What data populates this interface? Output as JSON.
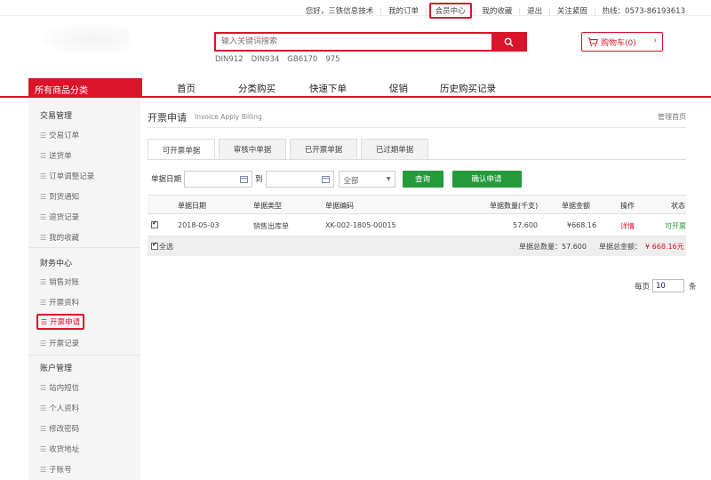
{
  "topbar": {
    "greeting": "您好，三铁信息技术",
    "my_orders": "我的订单",
    "member_center": "会员中心",
    "my_favorites": "我的收藏",
    "logout": "退出",
    "follow": "关注紧固",
    "hotline": "热线：0573-86193613"
  },
  "header": {
    "search_placeholder": "输入关键词搜索",
    "hot_words": [
      "DIN912",
      "DIN934",
      "GB6170",
      "975"
    ],
    "cart_label": "购物车(0)"
  },
  "nav": {
    "all_categories": "所有商品分类",
    "items": [
      "首页",
      "分类购买",
      "快速下单",
      "促销",
      "历史购买记录"
    ]
  },
  "sidebar": {
    "groups": [
      {
        "title": "交易管理",
        "items": [
          "交易订单",
          "送货单",
          "订单调整记录",
          "到货通知",
          "退货记录",
          "我的收藏"
        ]
      },
      {
        "title": "财务中心",
        "items": [
          "销售对账",
          "开票资料",
          "开票申请",
          "开票记录"
        ]
      },
      {
        "title": "账户管理",
        "items": [
          "站内短信",
          "个人资料",
          "修改密码",
          "收货地址",
          "子账号"
        ]
      }
    ],
    "active_item": "开票申请"
  },
  "main": {
    "title": "开票申请",
    "subtitle": "Invoice Apply Billing",
    "breadcrumb": "管理首页",
    "tabs": [
      "可开票单据",
      "审核中单据",
      "已开票单据",
      "已过期单据"
    ],
    "filter": {
      "date_label": "单据日期",
      "to_label": "到",
      "select_value": "全部",
      "query_button": "查询",
      "confirm_button": "确认申请"
    },
    "table": {
      "headers": [
        "单据日期",
        "单据类型",
        "单据编码",
        "单据数量(千支)",
        "单据金额",
        "操作",
        "状态"
      ],
      "rows": [
        {
          "date": "2018-05-03",
          "type": "销售出库单",
          "code": "XK-002-1805-00015",
          "qty": "57.600",
          "amount": "¥668.16",
          "action": "详情",
          "status": "可开票"
        }
      ],
      "select_all": "全选",
      "total_qty_label": "单据总数量：57.600",
      "total_amount_label": "单据总金额：",
      "total_amount_value": "¥ 668.16元"
    },
    "pager": {
      "per_page_label": "每页",
      "per_page_value": "10",
      "unit": "条"
    }
  },
  "colors": {
    "brand_red": "#d9142b",
    "button_green": "#239b3b",
    "status_green": "#239b3b"
  }
}
